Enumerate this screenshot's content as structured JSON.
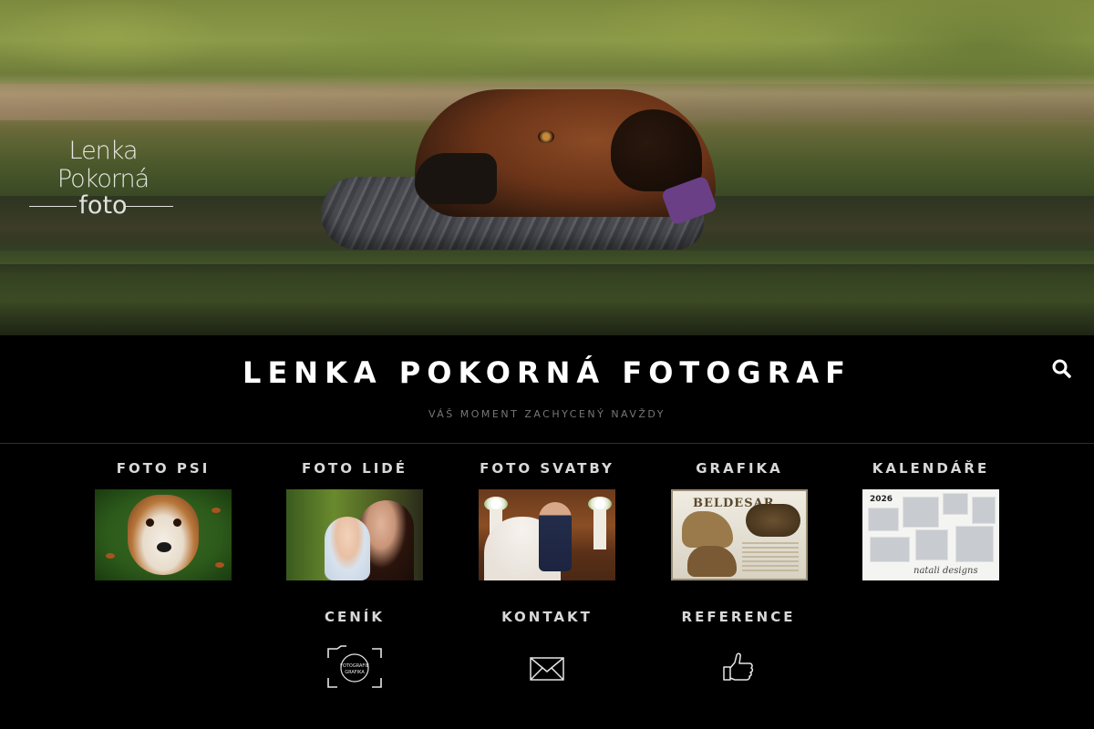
{
  "hero": {
    "watermark_line1": "Lenka Pokorná",
    "watermark_line2": "foto"
  },
  "header": {
    "title": "LENKA POKORNÁ FOTOGRAF",
    "tagline": "VÁŠ MOMENT ZACHYCENÝ NAVŽDY",
    "search_icon": "search-icon"
  },
  "nav": {
    "gallery": [
      {
        "label": "FOTO PSI"
      },
      {
        "label": "FOTO LIDÉ"
      },
      {
        "label": "FOTO SVATBY"
      },
      {
        "label": "GRAFIKA",
        "thumb_text": "BELDESAR"
      },
      {
        "label": "KALENDÁŘE",
        "thumb_year": "2026",
        "thumb_brand": "natali designs"
      }
    ],
    "pages": [
      {
        "label": "CENÍK",
        "icon": "camera-frame-icon",
        "icon_text_1": "FOTOGRAFIE",
        "icon_text_2": "GRAFIKA"
      },
      {
        "label": "KONTAKT",
        "icon": "envelope-icon"
      },
      {
        "label": "REFERENCE",
        "icon": "thumbs-up-icon"
      }
    ]
  },
  "colors": {
    "background": "#000000",
    "title": "#ffffff",
    "nav_label": "#d8d8d8",
    "tagline": "#777777"
  }
}
